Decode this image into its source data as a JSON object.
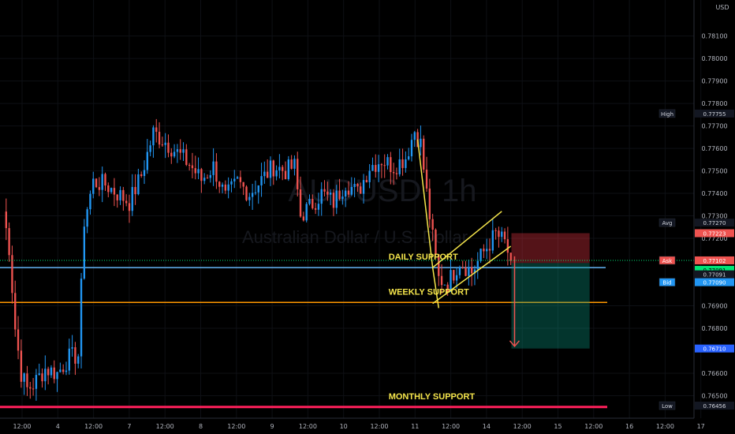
{
  "chart_data": {
    "type": "candlestick",
    "symbol": "AUDUSD",
    "interval": "1h",
    "description": "Australian Dollar / U.S. Dollar",
    "currency": "USD",
    "ylim": [
      0.764,
      0.7826
    ],
    "y_ticks": [
      "0.78100",
      "0.78000",
      "0.77900",
      "0.77800",
      "0.77700",
      "0.77600",
      "0.77500",
      "0.77400",
      "0.77300",
      "0.77200",
      "0.76900",
      "0.76800",
      "0.76600",
      "0.76500"
    ],
    "x_ticks": [
      "12:00",
      "4",
      "12:00",
      "7",
      "12:00",
      "8",
      "12:00",
      "9",
      "12:00",
      "10",
      "12:00",
      "11",
      "12:00",
      "14",
      "12:00",
      "15",
      "12:00",
      "16",
      "12:00",
      "17"
    ],
    "x_range": [
      0,
      230
    ],
    "price_tags": [
      {
        "label": "High",
        "value": "0.77755",
        "price": 0.77755,
        "color": "#131722",
        "text": "#d1d4dc"
      },
      {
        "label": "Avg",
        "value": "0.77270",
        "price": 0.7727,
        "color": "#131722",
        "text": "#d1d4dc"
      },
      {
        "label": "",
        "value": "0.77223",
        "price": 0.77223,
        "color": "#ef5350",
        "text": "#ffffff"
      },
      {
        "label": "Ask",
        "value": "0.77102",
        "price": 0.77102,
        "color": "#ef5350",
        "text": "#ffffff"
      },
      {
        "label": "",
        "value": "0.77091",
        "price": 0.7706,
        "color": "#00e676",
        "text": "#000000"
      },
      {
        "label": "",
        "value": "0.77091",
        "price": 0.7704,
        "color": "#131722",
        "text": "#d1d4dc"
      },
      {
        "label": "Bid",
        "value": "0.77090",
        "price": 0.77005,
        "color": "#2196f3",
        "text": "#ffffff"
      },
      {
        "label": "",
        "value": "0.76710",
        "price": 0.7671,
        "color": "#2962ff",
        "text": "#ffffff"
      },
      {
        "label": "Low",
        "value": "0.76456",
        "price": 0.76456,
        "color": "#131722",
        "text": "#d1d4dc"
      }
    ],
    "levels": [
      {
        "name": "DAILY SUPPORT",
        "price": 0.7707,
        "color": "#64b5f6",
        "label_x": 127
      },
      {
        "name": "WEEKLY SUPPORT",
        "price": 0.76915,
        "color": "#ff9800",
        "label_x": 127
      },
      {
        "name": "MONTHLY SUPPORT",
        "price": 0.7645,
        "color": "#ff1f5b",
        "label_x": 127
      }
    ],
    "channel": {
      "upper": [
        [
          143,
          0.7707
        ],
        [
          166,
          0.7732
        ]
      ],
      "lower": [
        [
          143,
          0.7691
        ],
        [
          169,
          0.77165
        ]
      ],
      "pole": [
        [
          138,
          0.7764
        ],
        [
          143,
          0.7707
        ]
      ]
    },
    "position": {
      "x_start": 170,
      "x_end": 190,
      "entry": 0.7709,
      "stop": 0.77223,
      "target": 0.7671
    },
    "arrow": {
      "x": 170,
      "from": 0.7712,
      "to": 0.7672
    },
    "anchors": [
      [
        0,
        0.7732
      ],
      [
        2,
        0.7716
      ],
      [
        4,
        0.768
      ],
      [
        6,
        0.766
      ],
      [
        8,
        0.7653
      ],
      [
        10,
        0.7655
      ],
      [
        14,
        0.7662
      ],
      [
        18,
        0.766
      ],
      [
        22,
        0.7667
      ],
      [
        25,
        0.7668
      ],
      [
        27,
        0.7728
      ],
      [
        30,
        0.7745
      ],
      [
        34,
        0.7744
      ],
      [
        38,
        0.774
      ],
      [
        42,
        0.7736
      ],
      [
        46,
        0.7748
      ],
      [
        50,
        0.7767
      ],
      [
        54,
        0.7763
      ],
      [
        58,
        0.7758
      ],
      [
        62,
        0.7753
      ],
      [
        66,
        0.7746
      ],
      [
        70,
        0.7752
      ],
      [
        74,
        0.7738
      ],
      [
        78,
        0.7745
      ],
      [
        82,
        0.774
      ],
      [
        86,
        0.7746
      ],
      [
        90,
        0.7752
      ],
      [
        94,
        0.775
      ],
      [
        97,
        0.7752
      ],
      [
        99,
        0.773
      ],
      [
        102,
        0.7734
      ],
      [
        106,
        0.774
      ],
      [
        110,
        0.7736
      ],
      [
        114,
        0.7745
      ],
      [
        118,
        0.774
      ],
      [
        122,
        0.7752
      ],
      [
        126,
        0.7755
      ],
      [
        130,
        0.7752
      ],
      [
        134,
        0.7756
      ],
      [
        137,
        0.7768
      ],
      [
        139,
        0.7762
      ],
      [
        141,
        0.774
      ],
      [
        143,
        0.772
      ],
      [
        145,
        0.7702
      ],
      [
        148,
        0.77
      ],
      [
        152,
        0.771
      ],
      [
        156,
        0.7705
      ],
      [
        160,
        0.7714
      ],
      [
        164,
        0.7722
      ],
      [
        167,
        0.7718
      ],
      [
        169,
        0.771
      ]
    ]
  }
}
